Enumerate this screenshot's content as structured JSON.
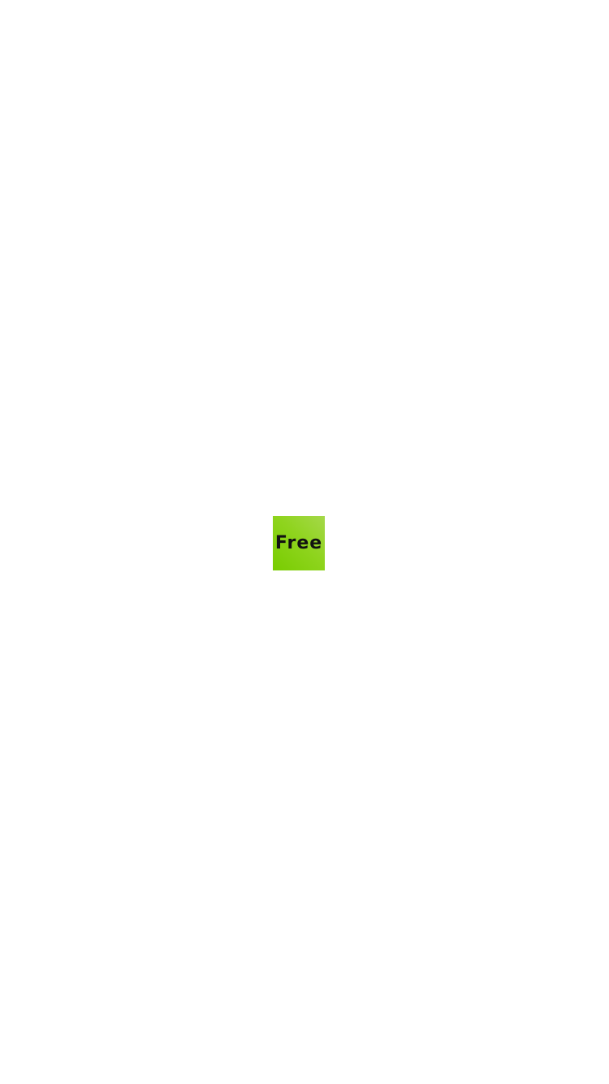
{
  "badge": {
    "label": "Free",
    "colors": {
      "gradient_start": "#78cc00",
      "gradient_end": "#a5d84a",
      "text": "#111111"
    }
  },
  "page": {
    "background": "#ffffff"
  }
}
